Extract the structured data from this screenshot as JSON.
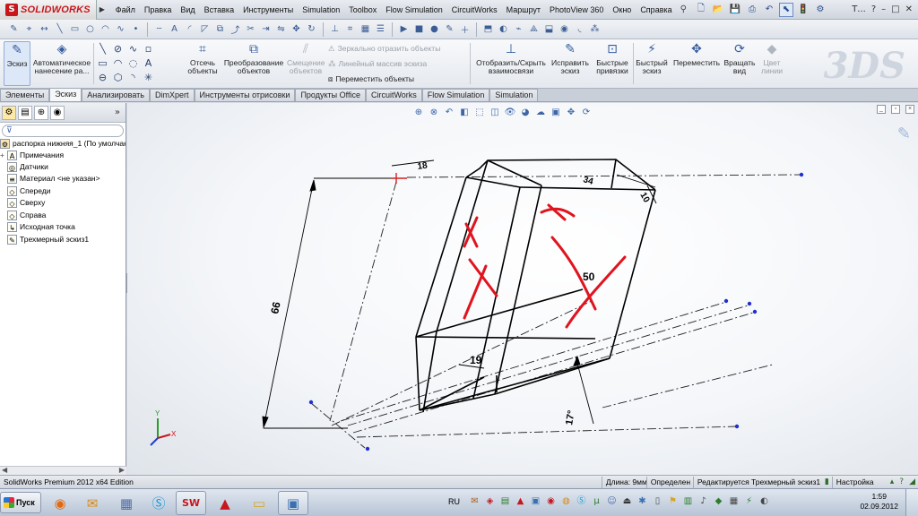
{
  "app": {
    "logo_text": "SOLIDWORKS",
    "logo_mark": "S"
  },
  "menu": {
    "items": [
      "Файл",
      "Правка",
      "Вид",
      "Вставка",
      "Инструменты",
      "Simulation",
      "Toolbox",
      "Flow Simulation",
      "CircuitWorks",
      "Маршрут",
      "PhotoView 360",
      "Окно",
      "Справка"
    ],
    "window_controls": [
      "Т...",
      "?",
      "–",
      "□",
      "✕"
    ]
  },
  "command_manager": {
    "sketch": "Эскиз",
    "smart_dimension": "Автоматическое нанесение ра...",
    "trim": "Отсечь объекты",
    "convert": "Преобразование объектов",
    "offset": "Смещение объектов",
    "mirror": "Зеркально отразить объекты",
    "linear_pattern": "Линейный массив эскиза",
    "move_entities": "Переместить объекты",
    "display_relations": "Отобразить/Скрыть взаимосвязи",
    "repair_sketch": "Исправить эскиз",
    "quick_snaps": "Быстрые привязки",
    "rapid_sketch": "Быстрый эскиз",
    "move": "Переместить",
    "rotate_view": "Вращать вид",
    "line_color": "Цвет линии"
  },
  "tabs": [
    "Элементы",
    "Эскиз",
    "Анализировать",
    "DimXpert",
    "Инструменты отрисовки",
    "Продукты Office",
    "CircuitWorks",
    "Flow Simulation",
    "Simulation"
  ],
  "active_tab": "Эскиз",
  "feature_tree": {
    "root": "распорка нижняя_1  (По умолчан",
    "items": [
      {
        "label": "Примечания",
        "icon": "annotations-icon",
        "glyph": "A",
        "expand": "+"
      },
      {
        "label": "Датчики",
        "icon": "sensors-icon",
        "glyph": "◎",
        "expand": ""
      },
      {
        "label": "Материал <не указан>",
        "icon": "material-icon",
        "glyph": "≡",
        "expand": ""
      },
      {
        "label": "Спереди",
        "icon": "plane-front-icon",
        "glyph": "◇",
        "expand": ""
      },
      {
        "label": "Сверху",
        "icon": "plane-top-icon",
        "glyph": "◇",
        "expand": ""
      },
      {
        "label": "Справа",
        "icon": "plane-right-icon",
        "glyph": "◇",
        "expand": ""
      },
      {
        "label": "Исходная точка",
        "icon": "origin-icon",
        "glyph": "↳",
        "expand": ""
      },
      {
        "label": "Трехмерный эскиз1",
        "icon": "3d-sketch-icon",
        "glyph": "✎",
        "expand": ""
      }
    ]
  },
  "graphics": {
    "dimensions": {
      "d18": "18",
      "d34": "34",
      "d10": "10",
      "d66": "66",
      "d50": "50",
      "d19": "19",
      "angle": "17°"
    },
    "colors": {
      "geometry": "#000000",
      "construction": "#1a1a1a",
      "markup": "#e0141e",
      "endpoint": "#1f2fd0",
      "origin_red": "#d42020"
    },
    "triad_labels": {
      "x": "X",
      "y": "Y"
    }
  },
  "status": {
    "edition": "SolidWorks Premium 2012 x64 Edition",
    "length": "Длина: 9мм",
    "defined": "Определен",
    "editing": "Редактируется Трехмерный эскиз1",
    "settings": "Настройка"
  },
  "taskbar": {
    "start": "Пуск",
    "lang": "RU",
    "time": "1:59",
    "date": "02.09.2012"
  }
}
